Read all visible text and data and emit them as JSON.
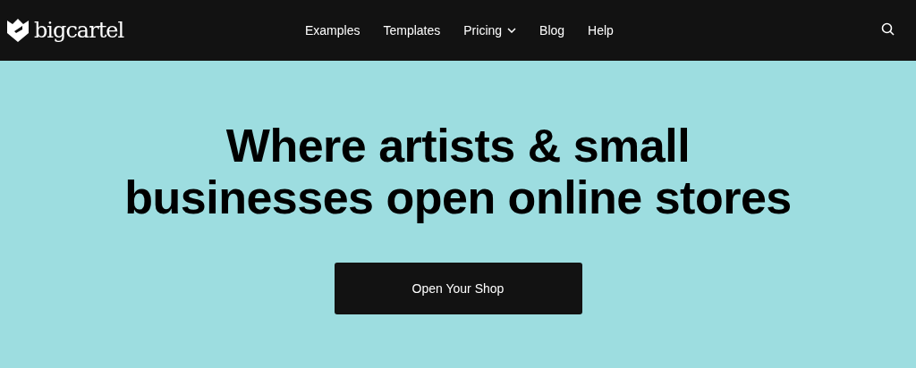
{
  "logo": {
    "text": "bigcartel"
  },
  "nav": [
    {
      "label": "Examples",
      "kind": "link"
    },
    {
      "label": "Templates",
      "kind": "link"
    },
    {
      "label": "Pricing",
      "kind": "dropdown"
    },
    {
      "label": "Blog",
      "kind": "link"
    },
    {
      "label": "Help",
      "kind": "link"
    }
  ],
  "hero": {
    "headline_lines": [
      "Where artists & small",
      "businesses open online stores"
    ],
    "cta": "Open Your Shop"
  }
}
